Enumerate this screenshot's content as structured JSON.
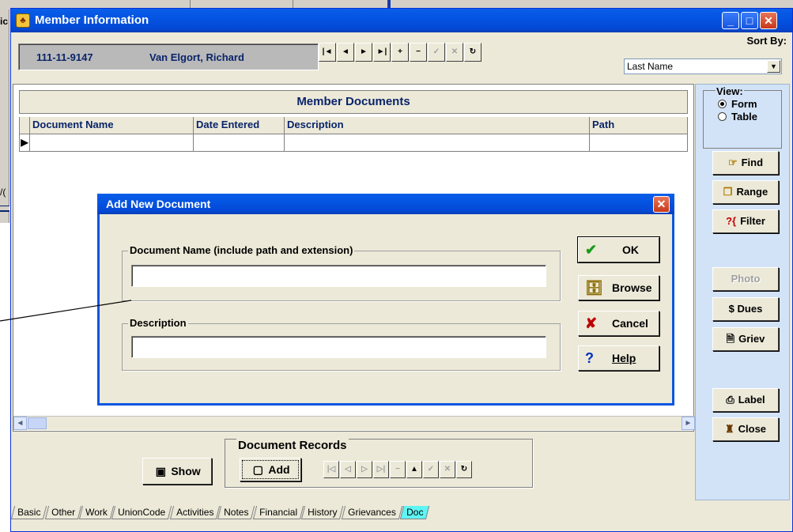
{
  "background": {
    "left_label": "ic",
    "left_label2": "/("
  },
  "window": {
    "title": "Member Information",
    "controls": {
      "minimize": "_",
      "maximize": "□",
      "close": "✕"
    }
  },
  "header": {
    "ssn": "111-11-9147",
    "name": "Van Elgort, Richard",
    "sort_by_label": "Sort By:",
    "sort_by_value": "Last Name"
  },
  "nav_buttons": [
    "|◄",
    "◄",
    "►",
    "►|",
    "+",
    "−",
    "✓",
    "✕",
    "↻"
  ],
  "documents": {
    "section_title": "Member Documents",
    "columns": [
      "Document Name",
      "Date Entered",
      "Description",
      "Path"
    ],
    "rows": [
      {
        "selector": "▶",
        "values": [
          "",
          "",
          "",
          ""
        ]
      }
    ]
  },
  "view": {
    "label": "View:",
    "options": [
      "Form",
      "Table"
    ],
    "selected": "Form"
  },
  "side_buttons": {
    "find": "Find",
    "range": "Range",
    "filter": "Filter",
    "photo": "Photo",
    "dues": "$ Dues",
    "griev": "Griev",
    "label": "Label",
    "close": "Close"
  },
  "records": {
    "title": "Document Records",
    "show": "Show",
    "add": "Add",
    "nav": [
      "|◁",
      "◁",
      "▷",
      "▷|",
      "−",
      "▲",
      "✓",
      "✕",
      "↻"
    ]
  },
  "tabs": [
    "Basic",
    "Other",
    "Work",
    "UnionCode",
    "Activities",
    "Notes",
    "Financial",
    "History",
    "Grievances",
    "Doc"
  ],
  "active_tab": "Doc",
  "dialog": {
    "title": "Add New Document",
    "doc_name_label": "Document Name (include path and extension)",
    "doc_name_value": "",
    "description_label": "Description",
    "description_value": "",
    "buttons": {
      "ok": "OK",
      "browse": "Browse",
      "cancel": "Cancel",
      "help": "Help"
    }
  },
  "colors": {
    "title_blue": "#0454e2",
    "label_navy": "#0a246a",
    "active_tab": "#5ff5f5",
    "side_panel": "#d3e3f7"
  }
}
